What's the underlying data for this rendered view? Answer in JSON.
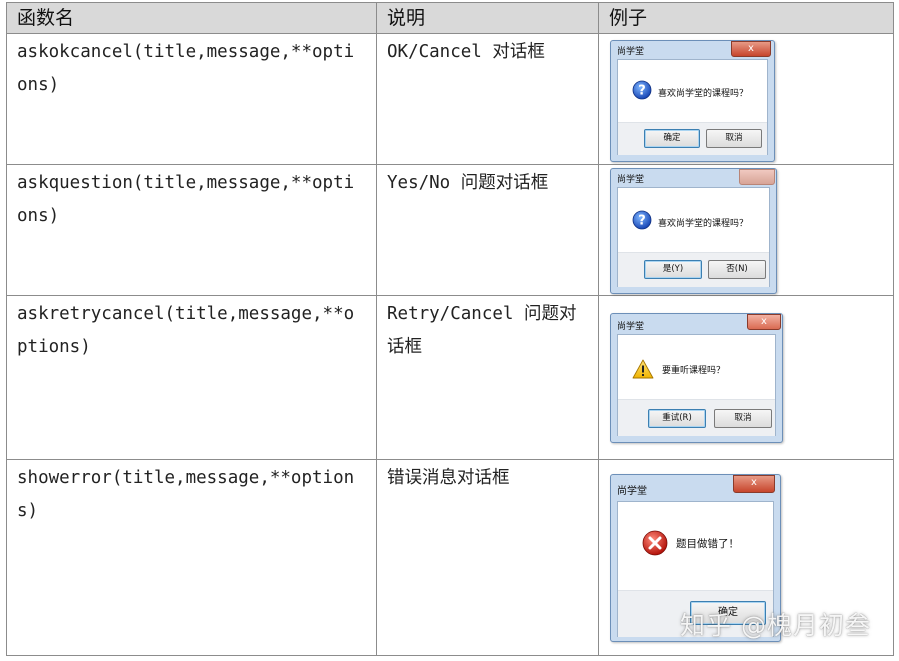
{
  "table": {
    "headers": [
      "函数名",
      "说明",
      "例子"
    ],
    "rows": [
      {
        "function": "askokcancel(title,message,**options)",
        "description": "OK/Cancel 对话框",
        "dialog": {
          "title": "尚学堂",
          "close": "x",
          "icon": "question-icon",
          "message": "喜欢尚学堂的课程吗？",
          "buttons": [
            "确定",
            "取消"
          ]
        }
      },
      {
        "function": "askquestion(title,message,**options)",
        "description": "Yes/No 问题对话框",
        "dialog": {
          "title": "尚学堂",
          "close": "",
          "icon": "question-icon",
          "message": "喜欢尚学堂的课程吗？",
          "buttons": [
            "是(Y)",
            "否(N)"
          ]
        }
      },
      {
        "function": "askretrycancel(title,message,**options)",
        "description": "Retry/Cancel 问题对话框",
        "dialog": {
          "title": "尚学堂",
          "close": "x",
          "icon": "warning-icon",
          "message": "要重听课程吗？",
          "buttons": [
            "重试(R)",
            "取消"
          ]
        }
      },
      {
        "function": "showerror(title,message,**options)",
        "description": "错误消息对话框",
        "dialog": {
          "title": "尚学堂",
          "close": "x",
          "icon": "error-icon",
          "message": "题目做错了！",
          "buttons": [
            "确定"
          ]
        }
      }
    ]
  },
  "watermark": "知乎 @槐月初叁"
}
